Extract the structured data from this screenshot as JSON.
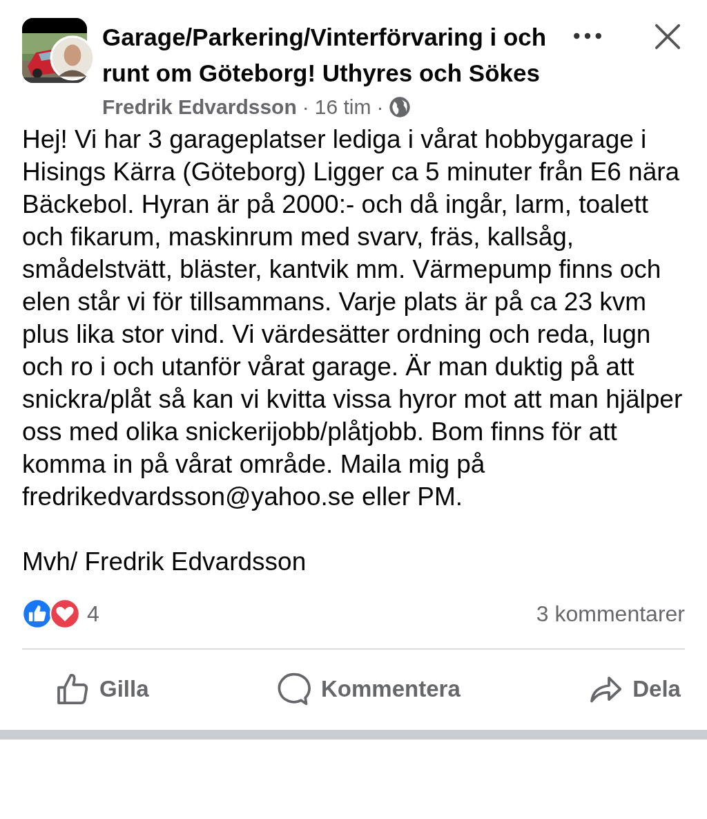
{
  "group": {
    "title": "Garage/Parkering/Vinterförvaring i och runt om Göteborg! Uthyres och Sökes"
  },
  "byline": {
    "author": "Fredrik Edvardsson",
    "separator_1": "·",
    "time": "16 tim",
    "separator_2": "·"
  },
  "post": {
    "paragraphs": [
      "Hej! Vi har 3 garageplatser lediga i vårat hobbygarage i Hisings Kärra (Göteborg) Ligger ca 5 minuter från E6 nära Bäckebol. Hyran är på 2000:- och då ingår, larm, toalett och fikarum, maskinrum med svarv, fräs, kallsåg, smådelstvätt, bläster, kantvik mm. Värmepump finns och elen står vi för tillsammans. Varje plats är på ca 23 kvm plus lika stor vind. Vi värdesätter ordning och reda, lugn och ro i och utanför vårat garage. Är man duktig på att snickra/plåt så kan vi kvitta vissa hyror mot att man hjälper oss med olika snickerijobb/plåtjobb. Bom finns för att komma in på vårat område. Maila mig på fredrikedvardsson@yahoo.se eller PM.",
      "Mvh/ Fredrik Edvardsson"
    ]
  },
  "reactions": {
    "count": "4",
    "comments": "3 kommentarer"
  },
  "actions": [
    {
      "kind": "like",
      "label": "Gilla"
    },
    {
      "kind": "comment",
      "label": "Kommentera"
    },
    {
      "kind": "share",
      "label": "Dela"
    }
  ]
}
